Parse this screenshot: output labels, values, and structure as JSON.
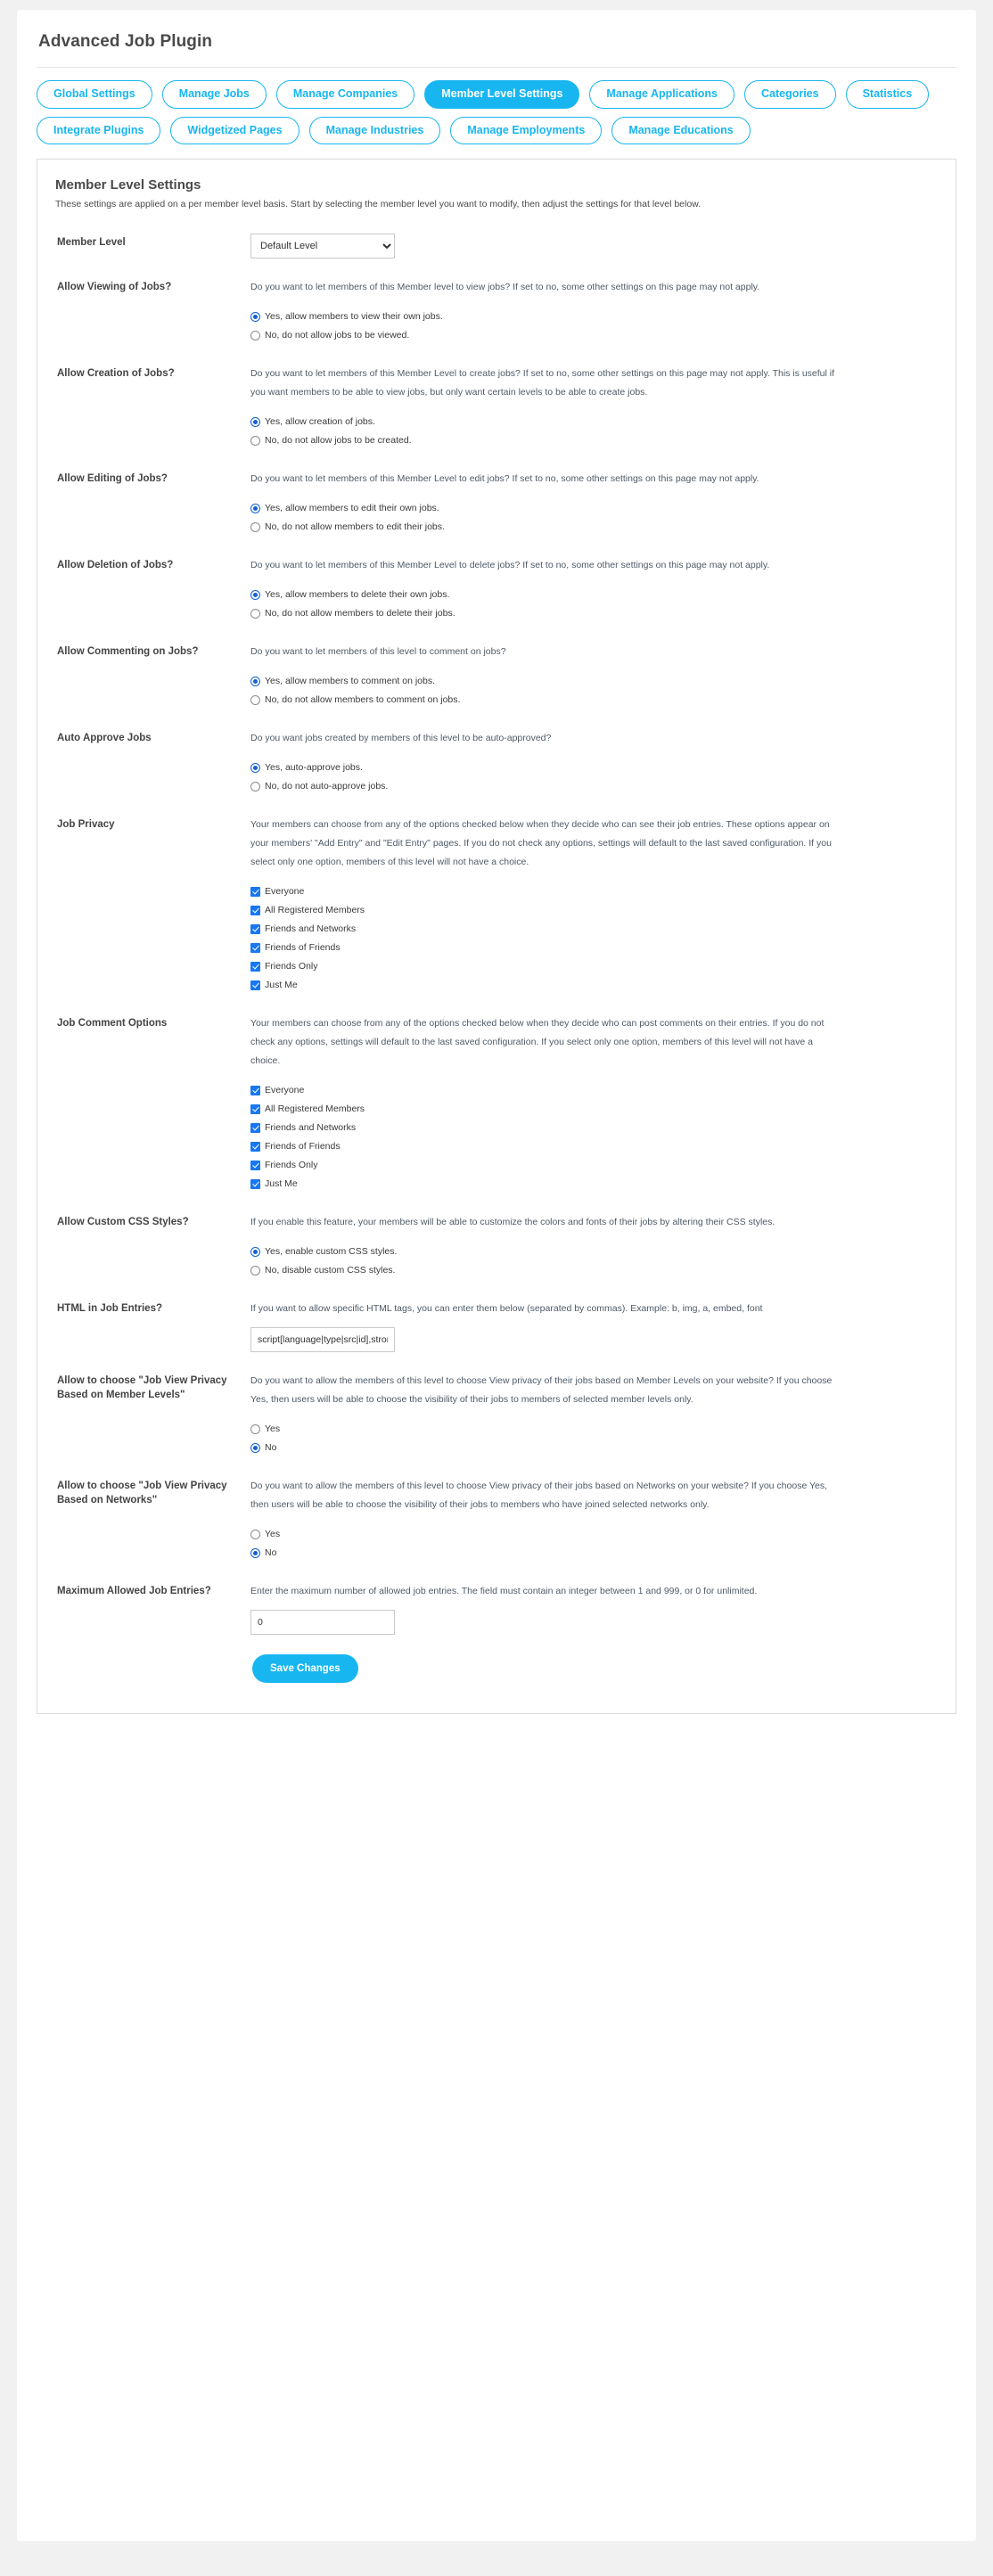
{
  "header": {
    "app_title": "Advanced Job Plugin"
  },
  "tabs": [
    {
      "label": "Global Settings",
      "active": false
    },
    {
      "label": "Manage Jobs",
      "active": false
    },
    {
      "label": "Manage Companies",
      "active": false
    },
    {
      "label": "Member Level Settings",
      "active": true
    },
    {
      "label": "Manage Applications",
      "active": false
    },
    {
      "label": "Categories",
      "active": false
    },
    {
      "label": "Statistics",
      "active": false
    },
    {
      "label": "Integrate Plugins",
      "active": false
    },
    {
      "label": "Widgetized Pages",
      "active": false
    },
    {
      "label": "Manage Industries",
      "active": false
    },
    {
      "label": "Manage Employments",
      "active": false
    },
    {
      "label": "Manage Educations",
      "active": false
    }
  ],
  "card": {
    "title": "Member Level Settings",
    "subtitle": "These settings are applied on a per member level basis. Start by selecting the member level you want to modify, then adjust the settings for that level below."
  },
  "member_level": {
    "label": "Member Level",
    "selected": "Default Level",
    "options": [
      "Default Level"
    ]
  },
  "allow_viewing": {
    "label": "Allow Viewing of Jobs?",
    "description": "Do you want to let members of this Member level to view jobs? If set to no, some other settings on this page may not apply.",
    "options": [
      {
        "label": "Yes, allow members to view their own jobs.",
        "selected": true
      },
      {
        "label": "No, do not allow jobs to be viewed.",
        "selected": false
      }
    ]
  },
  "allow_creation": {
    "label": "Allow Creation of Jobs?",
    "description": "Do you want to let members of this Member Level to create jobs? If set to no, some other settings on this page may not apply. This is useful if you want members to be able to view jobs, but only want certain levels to be able to create jobs.",
    "options": [
      {
        "label": "Yes, allow creation of jobs.",
        "selected": true
      },
      {
        "label": "No, do not allow jobs to be created.",
        "selected": false
      }
    ]
  },
  "allow_editing": {
    "label": "Allow Editing of Jobs?",
    "description": "Do you want to let members of this Member Level to edit jobs? If set to no, some other settings on this page may not apply.",
    "options": [
      {
        "label": "Yes, allow members to edit their own jobs.",
        "selected": true
      },
      {
        "label": "No, do not allow members to edit their jobs.",
        "selected": false
      }
    ]
  },
  "allow_deletion": {
    "label": "Allow Deletion of Jobs?",
    "description": "Do you want to let members of this Member Level to delete jobs? If set to no, some other settings on this page may not apply.",
    "options": [
      {
        "label": "Yes, allow members to delete their own jobs.",
        "selected": true
      },
      {
        "label": "No, do not allow members to delete their jobs.",
        "selected": false
      }
    ]
  },
  "allow_commenting": {
    "label": "Allow Commenting on Jobs?",
    "description": "Do you want to let members of this level to comment on jobs?",
    "options": [
      {
        "label": "Yes, allow members to comment on jobs.",
        "selected": true
      },
      {
        "label": "No, do not allow members to comment on jobs.",
        "selected": false
      }
    ]
  },
  "auto_approve": {
    "label": "Auto Approve Jobs",
    "description": "Do you want jobs created by members of this level to be auto-approved?",
    "options": [
      {
        "label": "Yes, auto-approve jobs.",
        "selected": true
      },
      {
        "label": "No, do not auto-approve jobs.",
        "selected": false
      }
    ]
  },
  "job_privacy": {
    "label": "Job Privacy",
    "description": "Your members can choose from any of the options checked below when they decide who can see their job entries. These options appear on your members' \"Add Entry\" and \"Edit Entry\" pages. If you do not check any options, settings will default to the last saved configuration. If you select only one option, members of this level will not have a choice.",
    "options": [
      {
        "label": "Everyone",
        "checked": true
      },
      {
        "label": "All Registered Members",
        "checked": true
      },
      {
        "label": "Friends and Networks",
        "checked": true
      },
      {
        "label": "Friends of Friends",
        "checked": true
      },
      {
        "label": "Friends Only",
        "checked": true
      },
      {
        "label": "Just Me",
        "checked": true
      }
    ]
  },
  "job_comment_options": {
    "label": "Job Comment Options",
    "description": "Your members can choose from any of the options checked below when they decide who can post comments on their entries. If you do not check any options, settings will default to the last saved configuration. If you select only one option, members of this level will not have a choice.",
    "options": [
      {
        "label": "Everyone",
        "checked": true
      },
      {
        "label": "All Registered Members",
        "checked": true
      },
      {
        "label": "Friends and Networks",
        "checked": true
      },
      {
        "label": "Friends of Friends",
        "checked": true
      },
      {
        "label": "Friends Only",
        "checked": true
      },
      {
        "label": "Just Me",
        "checked": true
      }
    ]
  },
  "custom_css": {
    "label": "Allow Custom CSS Styles?",
    "description": "If you enable this feature, your members will be able to customize the colors and fonts of their jobs by altering their CSS styles.",
    "options": [
      {
        "label": "Yes, enable custom CSS styles.",
        "selected": true
      },
      {
        "label": "No, disable custom CSS styles.",
        "selected": false
      }
    ]
  },
  "html_in_entries": {
    "label": "HTML in Job Entries?",
    "description": "If you want to allow specific HTML tags, you can enter them below (separated by commas). Example: b, img, a, embed, font",
    "value": "script[language|type|src|id],strong, b, em, i, u"
  },
  "privacy_member_levels": {
    "label": "Allow to choose \"Job View Privacy Based on Member Levels\"",
    "description": "Do you want to allow the members of this level to choose View privacy of their jobs based on Member Levels on your website? If you choose Yes, then users will be able to choose the visibility of their jobs to members of selected member levels only.",
    "options": [
      {
        "label": "Yes",
        "selected": false
      },
      {
        "label": "No",
        "selected": true
      }
    ]
  },
  "privacy_networks": {
    "label": "Allow to choose \"Job View Privacy Based on Networks\"",
    "description": "Do you want to allow the members of this level to choose View privacy of their jobs based on Networks on your website? If you choose Yes, then users will be able to choose the visibility of their jobs to members who have joined selected networks only.",
    "options": [
      {
        "label": "Yes",
        "selected": false
      },
      {
        "label": "No",
        "selected": true
      }
    ]
  },
  "max_entries": {
    "label": "Maximum Allowed Job Entries?",
    "description": "Enter the maximum number of allowed job entries. The field must contain an integer between 1 and 999, or 0 for unlimited.",
    "value": "0"
  },
  "save": {
    "label": "Save Changes"
  },
  "colors": {
    "accent": "#18b6f0",
    "radio_on": "#1060d8",
    "checkbox_on": "#1877f2",
    "page_bg": "#f1f1f1"
  }
}
